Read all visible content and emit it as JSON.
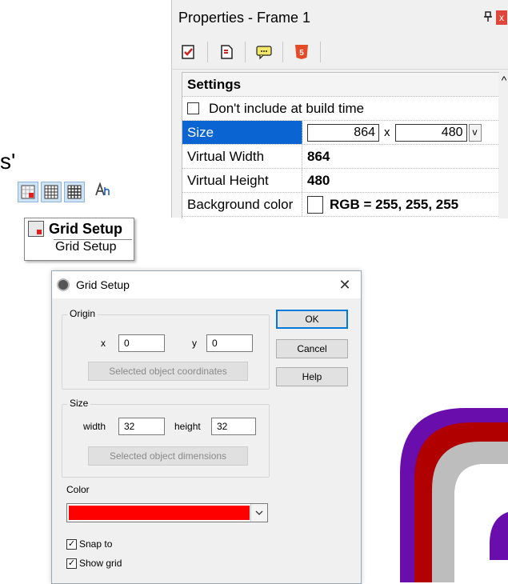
{
  "properties": {
    "title": "Properties - Frame 1",
    "pin_glyph": "¤",
    "close_glyph": "x",
    "toolbar_icons": [
      "properties-icon",
      "page-icon",
      "comment-icon",
      "html5-icon"
    ],
    "section": "Settings",
    "exclude_label": "Don't include at build time",
    "rows": {
      "size": {
        "label": "Size",
        "width": "864",
        "sep": "x",
        "height": "480",
        "dropdown": "v"
      },
      "virtual_width": {
        "label": "Virtual Width",
        "value": "864"
      },
      "virtual_height": {
        "label": "Virtual Height",
        "value": "480"
      },
      "background": {
        "label": "Background color",
        "value": "RGB = 255, 255, 255"
      }
    }
  },
  "left_fragment": {
    "partial_text": "s'",
    "tooltip_title": "Grid Setup",
    "tooltip_subtitle": "Grid Setup"
  },
  "dialog": {
    "title": "Grid Setup",
    "close": "✕",
    "origin": {
      "label": "Origin",
      "x_label": "x",
      "x_value": "0",
      "y_label": "y",
      "y_value": "0",
      "button": "Selected object coordinates"
    },
    "size": {
      "label": "Size",
      "width_label": "width",
      "width_value": "32",
      "height_label": "height",
      "height_value": "32",
      "button": "Selected object dimensions"
    },
    "color_label": "Color",
    "color_value": "#ff0000",
    "ok": "OK",
    "cancel": "Cancel",
    "help": "Help",
    "snap_to": {
      "label": "Snap to",
      "checked": true
    },
    "show_grid": {
      "label": "Show grid",
      "checked": true
    }
  },
  "colors": {
    "selection": "#0a64d2",
    "arc_purple": "#6a0dad",
    "arc_red": "#b00000",
    "arc_gray": "#bdbdbd",
    "grid_color": "#ff0000"
  }
}
